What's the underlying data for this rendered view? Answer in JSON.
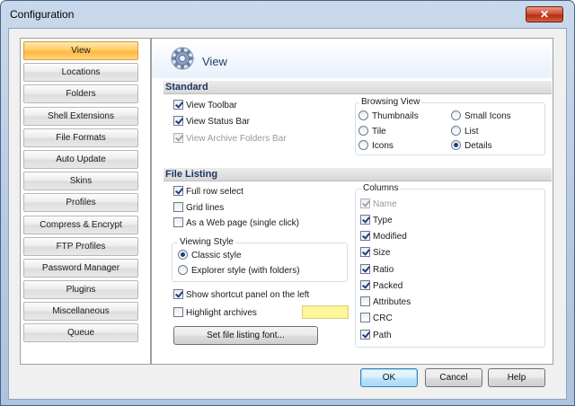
{
  "window": {
    "title": "Configuration",
    "close_label": "✕"
  },
  "nav": {
    "items": [
      {
        "label": "View",
        "active": true
      },
      {
        "label": "Locations"
      },
      {
        "label": "Folders"
      },
      {
        "label": "Shell Extensions"
      },
      {
        "label": "File Formats"
      },
      {
        "label": "Auto Update"
      },
      {
        "label": "Skins"
      },
      {
        "label": "Profiles"
      },
      {
        "label": "Compress & Encrypt"
      },
      {
        "label": "FTP Profiles"
      },
      {
        "label": "Password Manager"
      },
      {
        "label": "Plugins"
      },
      {
        "label": "Miscellaneous"
      },
      {
        "label": "Queue"
      }
    ]
  },
  "panel": {
    "title": "View",
    "icon": "gear-icon",
    "standard": {
      "heading": "Standard",
      "view_toolbar": "View Toolbar",
      "view_status_bar": "View Status Bar",
      "view_archive_folders_bar": "View Archive Folders Bar",
      "browsing_view": {
        "label": "Browsing View",
        "thumbnails": "Thumbnails",
        "small_icons": "Small Icons",
        "tile": "Tile",
        "list": "List",
        "icons": "Icons",
        "details": "Details",
        "selected": "Details"
      }
    },
    "file_listing": {
      "heading": "File Listing",
      "full_row_select": "Full row select",
      "grid_lines": "Grid lines",
      "as_web_page": "As a Web page (single click)",
      "viewing_style": {
        "label": "Viewing Style",
        "classic": "Classic style",
        "explorer": "Explorer style (with folders)",
        "selected": "Classic style"
      },
      "show_shortcut_panel": "Show shortcut panel on the left",
      "highlight_archives": "Highlight archives",
      "highlight_color": "#fff59a",
      "font_button": "Set file listing font...",
      "columns": {
        "label": "Columns",
        "name": "Name",
        "type": "Type",
        "modified": "Modified",
        "size": "Size",
        "ratio": "Ratio",
        "packed": "Packed",
        "attributes": "Attributes",
        "crc": "CRC",
        "path": "Path"
      }
    }
  },
  "footer": {
    "ok": "OK",
    "cancel": "Cancel",
    "help": "Help"
  },
  "colors": {
    "accent": "#ffb53d",
    "heading": "#1e3560"
  }
}
